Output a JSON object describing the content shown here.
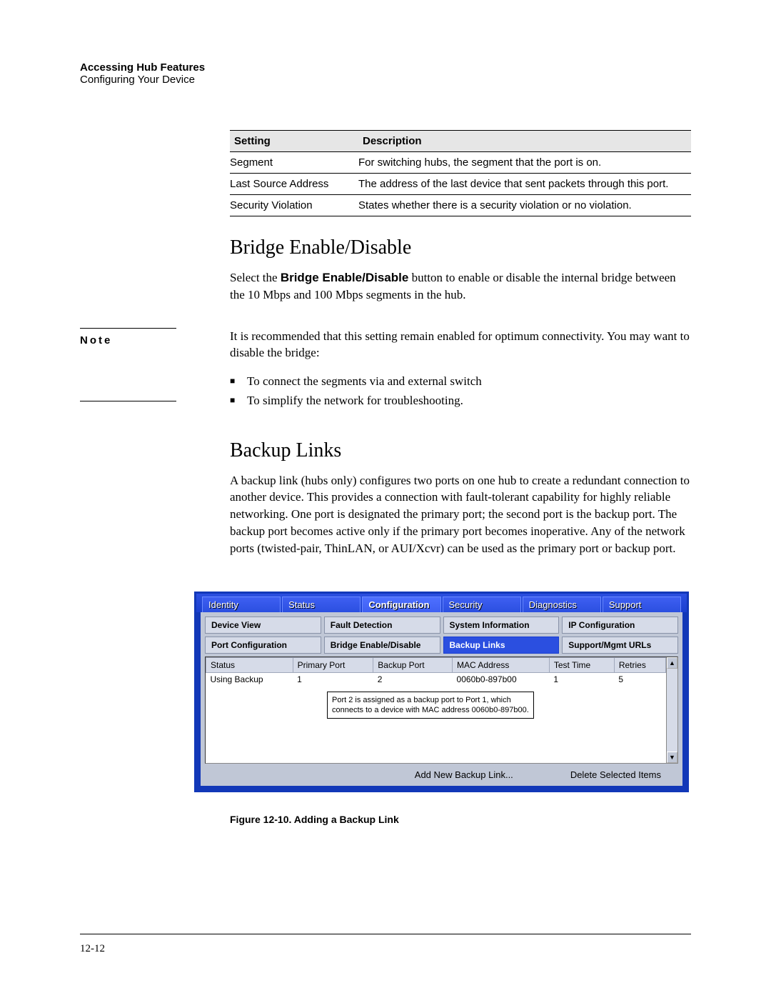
{
  "header": {
    "title": "Accessing Hub Features",
    "subtitle": "Configuring Your Device"
  },
  "table": {
    "head": {
      "setting": "Setting",
      "description": "Description"
    },
    "rows": [
      {
        "setting": "Segment",
        "description": "For switching hubs, the segment that the port is on."
      },
      {
        "setting": "Last Source Address",
        "description": "The address of the last device that sent packets through this port."
      },
      {
        "setting": "Security Violation",
        "description": "States whether there is a security violation or no violation."
      }
    ]
  },
  "section1": {
    "heading": "Bridge Enable/Disable",
    "para_prefix": "Select the ",
    "para_bold": "Bridge Enable/Disable",
    "para_suffix": " button to enable or disable the internal bridge between the 10 Mbps and 100 Mbps segments in the hub."
  },
  "note": {
    "label": "Note",
    "para": "It is recommended that this setting remain enabled for optimum connectivity. You may want to disable the bridge:",
    "bullets": [
      "To connect the segments via and external switch",
      "To simplify the network for troubleshooting."
    ]
  },
  "section2": {
    "heading": "Backup Links",
    "para": "A backup link (hubs only) configures two ports on one hub to create a redundant connection to another device. This provides a connection with fault-tolerant capability for highly reliable networking. One port is designated the primary port; the second port is the backup port. The backup port becomes active only if the primary port becomes inoperative. Any of the network ports (twisted-pair, ThinLAN, or AUI/Xcvr) can be used as the primary port or backup port."
  },
  "shot": {
    "tabs1": [
      "Identity",
      "Status",
      "Configuration",
      "Security",
      "Diagnostics",
      "Support"
    ],
    "tabs1_active": 2,
    "tabs2": [
      [
        "Device View",
        "Fault Detection",
        "System Information",
        "IP Configuration"
      ],
      [
        "Port Configuration",
        "Bridge Enable/Disable",
        "Backup Links",
        "Support/Mgmt URLs"
      ]
    ],
    "tabs2_active": "Backup Links",
    "grid": {
      "cols": [
        "Status",
        "Primary Port",
        "Backup Port",
        "MAC Address",
        "Test Time",
        "Retries"
      ],
      "row": [
        "Using Backup",
        "1",
        "2",
        "0060b0-897b00",
        "1",
        "5"
      ]
    },
    "callout": "Port 2 is assigned as a backup port to Port 1, which connects to a device with MAC address 0060b0-897b00.",
    "actions": {
      "add": "Add New Backup Link...",
      "delete": "Delete Selected Items"
    },
    "scroll": {
      "up": "▲",
      "down": "▼"
    }
  },
  "fig_caption": "Figure 12-10. Adding a Backup Link",
  "page_number": "12-12"
}
